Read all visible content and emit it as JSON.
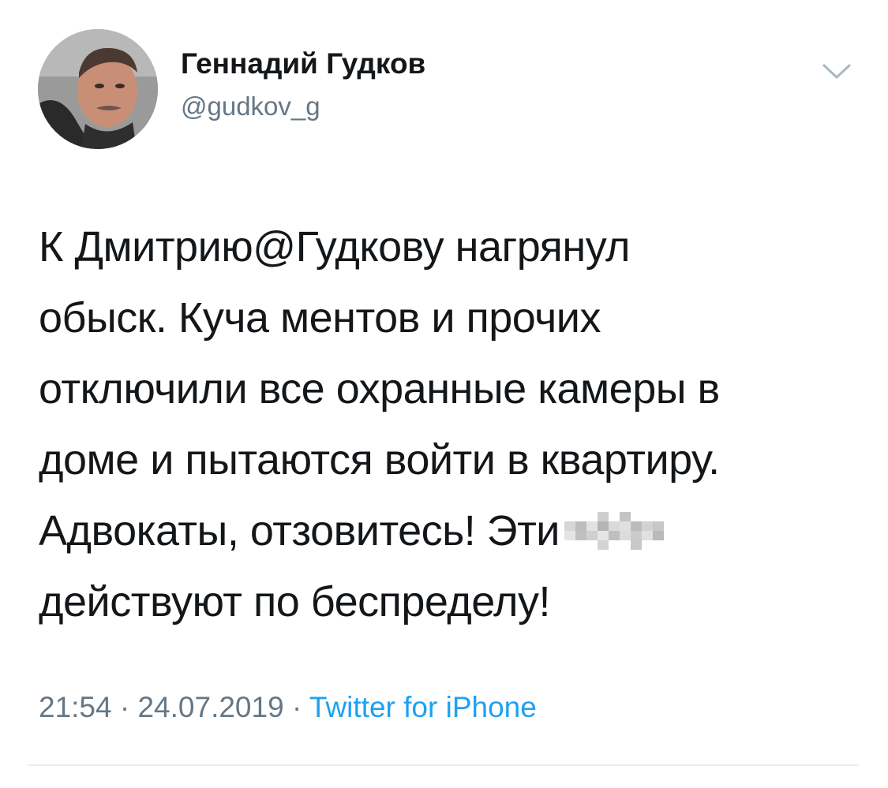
{
  "author": {
    "name": "Геннадий Гудков",
    "handle": "@gudkov_g"
  },
  "tweet": {
    "lines": [
      "К Дмитрию@Гудкову нагрянул",
      "обыск. Куча ментов и прочих",
      "отключили все охранные камеры в",
      "доме и пытаются войти в квартиру.",
      "Адвокаты, отзовитесь! Эти",
      "действуют по беспределу!"
    ],
    "censored_word": "pixelated"
  },
  "meta": {
    "time": "21:54",
    "separator": "·",
    "date": "24.07.2019",
    "source": "Twitter for iPhone"
  },
  "icons": {
    "menu": "chevron-down-icon",
    "avatar": "profile-photo"
  },
  "colors": {
    "text": "#14171a",
    "secondary": "#657786",
    "link": "#1da1f2",
    "divider": "#e6ecf0"
  }
}
